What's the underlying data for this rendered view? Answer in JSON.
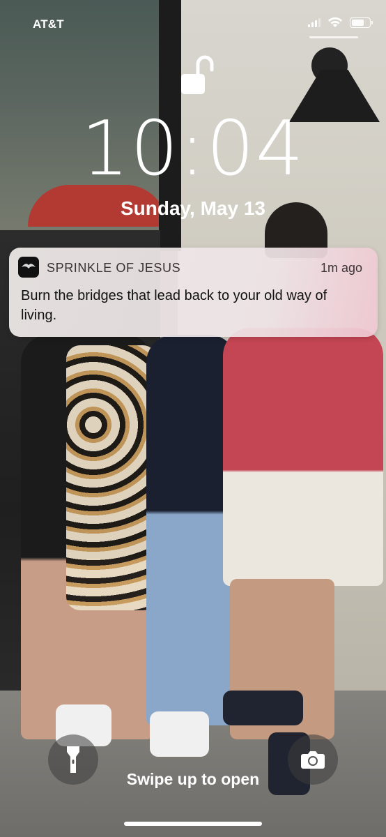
{
  "status_bar": {
    "carrier": "AT&T",
    "battery_level": 0.6,
    "signal_bars": 3,
    "icons": [
      "signal-icon",
      "wifi-icon",
      "battery-icon"
    ]
  },
  "lock": {
    "icon": "unlocked-padlock-icon",
    "state": "unlocked"
  },
  "clock": {
    "time": "10:04",
    "date": "Sunday, May 13"
  },
  "notification": {
    "app_name": "SPRINKLE OF JESUS",
    "time_ago": "1m ago",
    "message": "Burn the bridges that lead back to your old way of living."
  },
  "bottom": {
    "flashlight_icon": "flashlight-icon",
    "camera_icon": "camera-icon",
    "hint": "Swipe up to open"
  }
}
